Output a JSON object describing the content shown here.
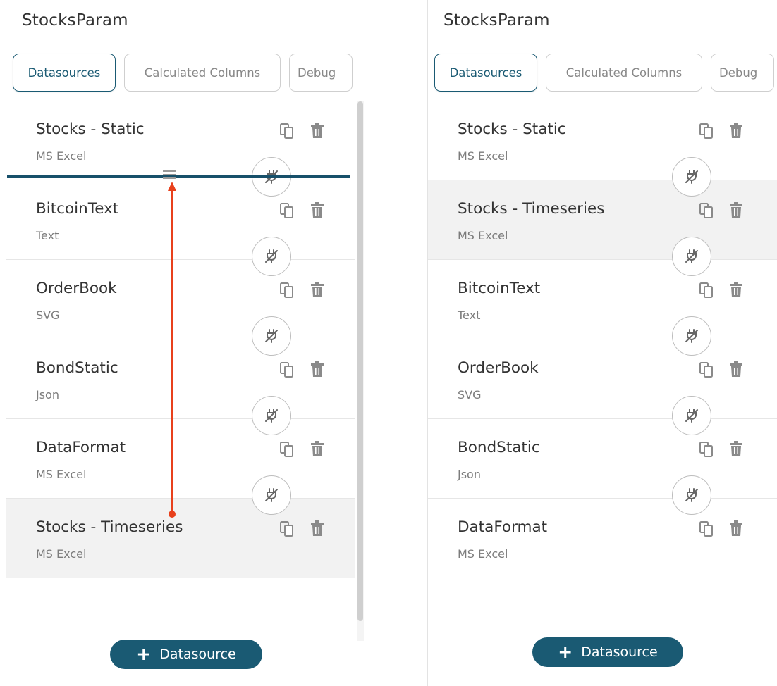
{
  "left_panel": {
    "title": "StocksParam",
    "tabs": [
      "Datasources",
      "Calculated Columns",
      "Debug"
    ],
    "items": [
      {
        "name": "Stocks - Static",
        "type": "MS Excel"
      },
      {
        "name": "BitcoinText",
        "type": "Text"
      },
      {
        "name": "OrderBook",
        "type": "SVG"
      },
      {
        "name": "BondStatic",
        "type": "Json"
      },
      {
        "name": "DataFormat",
        "type": "MS Excel"
      },
      {
        "name": "Stocks - Timeseries",
        "type": "MS Excel"
      }
    ],
    "add_label": "Datasource"
  },
  "right_panel": {
    "title": "StocksParam",
    "tabs": [
      "Datasources",
      "Calculated Columns",
      "Debug"
    ],
    "items": [
      {
        "name": "Stocks - Static",
        "type": "MS Excel"
      },
      {
        "name": "Stocks - Timeseries",
        "type": "MS Excel"
      },
      {
        "name": "BitcoinText",
        "type": "Text"
      },
      {
        "name": "OrderBook",
        "type": "SVG"
      },
      {
        "name": "BondStatic",
        "type": "Json"
      },
      {
        "name": "DataFormat",
        "type": "MS Excel"
      }
    ],
    "add_label": "Datasource"
  },
  "colors": {
    "accent": "#1a5a73",
    "drop_line": "#17506a",
    "drag_arrow": "#e8401c",
    "selected_row": "#f2f2f2",
    "icon_gray": "#8a8a8a"
  },
  "icons": {
    "copy": "copy-icon",
    "delete": "trash-icon",
    "connect": "plug-icon",
    "drag": "drag-handle-icon",
    "add": "plus-icon"
  }
}
